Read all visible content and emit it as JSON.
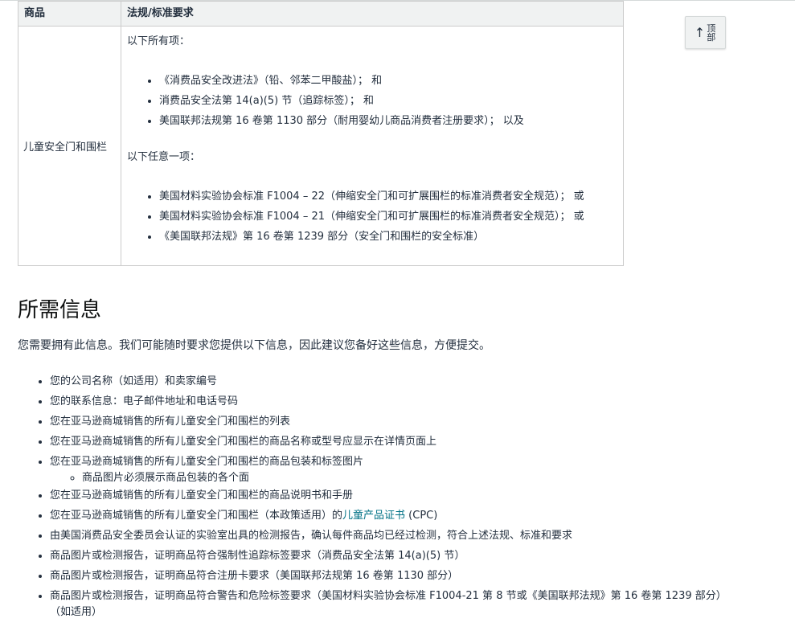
{
  "table": {
    "headers": [
      "商品",
      "法规/标准要求"
    ],
    "product": "儿童安全门和围栏",
    "all_heading": "以下所有项：",
    "all_items": [
      "《消费品安全改进法》（铅、邻苯二甲酸盐）； 和",
      "消费品安全法第 14(a)(5) 节（追踪标签）； 和",
      "美国联邦法规第 16 卷第 1130 部分（耐用婴幼儿商品消费者注册要求）； 以及"
    ],
    "any_heading": "以下任意一项：",
    "any_items": [
      "美国材料实验协会标准 F1004 – 22（伸缩安全门和可扩展围栏的标准消费者安全规范）； 或",
      "美国材料实验协会标准 F1004 – 21（伸缩安全门和可扩展围栏的标准消费者安全规范）； 或",
      "《美国联邦法规》第 16 卷第 1239 部分（安全门和围栏的安全标准）"
    ]
  },
  "back_to_top": {
    "label": "顶部",
    "icon": "arrow-up-icon"
  },
  "section": {
    "title": "所需信息",
    "intro": "您需要拥有此信息。我们可能随时要求您提供以下信息，因此建议您备好这些信息，方便提交。",
    "items": [
      "您的公司名称（如适用）和卖家编号",
      "您的联系信息：电子邮件地址和电话号码",
      "您在亚马逊商城销售的所有儿童安全门和围栏的列表",
      "您在亚马逊商城销售的所有儿童安全门和围栏的商品名称或型号应显示在详情页面上",
      "您在亚马逊商城销售的所有儿童安全门和围栏的商品包装和标签图片",
      "您在亚马逊商城销售的所有儿童安全门和围栏的商品说明书和手册",
      "由美国消费品安全委员会认证的实验室出具的检测报告，确认每件商品均已经过检测，符合上述法规、标准和要求",
      "商品图片或检测报告，证明商品符合强制性追踪标签要求（消费品安全法第 14(a)(5) 节）",
      "商品图片或检测报告，证明商品符合注册卡要求（美国联邦法规第 16 卷第 1130 部分）",
      "商品图片或检测报告，证明商品符合警告和危险标签要求（美国材料实验协会标准 F1004-21 第 8 节或《美国联邦法规》第 16 卷第 1239 部分）（如适用）"
    ],
    "sub_item": "商品图片必须展示商品包装的各个面",
    "cpc_prefix": "您在亚马逊商城销售的所有儿童安全门和围栏（本政策适用）的",
    "cpc_link": "儿童产品证书",
    "cpc_suffix": " (CPC)"
  },
  "colors": {
    "link": "#007185",
    "header_bg": "#f0f2f2",
    "text": "#232f3e"
  }
}
